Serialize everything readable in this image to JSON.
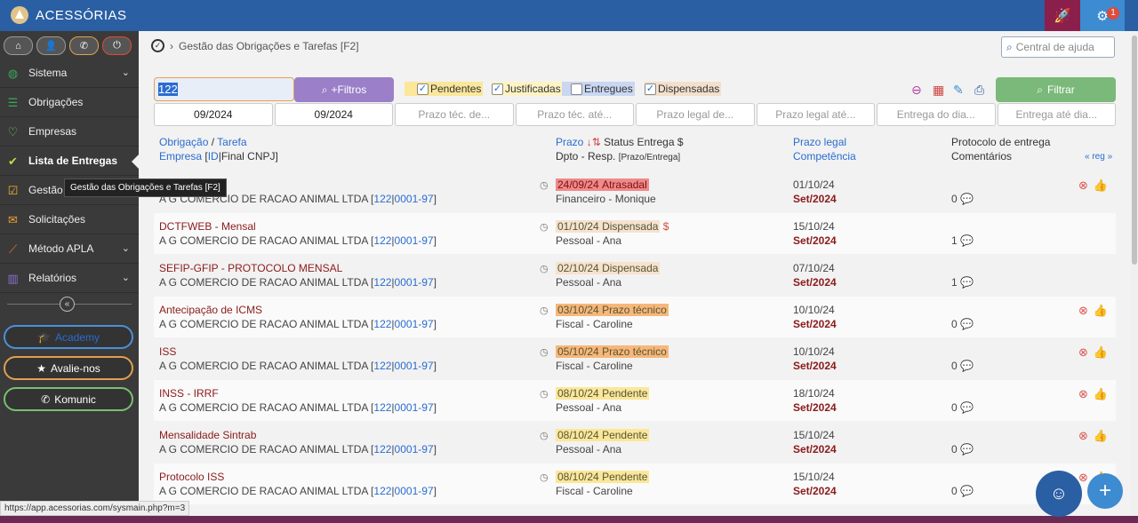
{
  "app": {
    "brand": "ACESSÓRIAS",
    "notification_count": "1"
  },
  "sidebar": {
    "items": [
      {
        "label": "Sistema",
        "icon": "globe-icon",
        "color": "#3aa55a",
        "has_chevron": true
      },
      {
        "label": "Obrigações",
        "icon": "list-icon",
        "color": "#3aa55a",
        "has_chevron": false
      },
      {
        "label": "Empresas",
        "icon": "heart-icon",
        "color": "#7ac070",
        "has_chevron": false
      },
      {
        "label": "Lista de Entregas",
        "icon": "check-circle-icon",
        "color": "#c8d84a",
        "has_chevron": false
      },
      {
        "label": "Gestão de processos",
        "icon": "checkbox-icon",
        "color": "#f0b030",
        "has_chevron": false
      },
      {
        "label": "Solicitações",
        "icon": "chat-icon",
        "color": "#f0a030",
        "has_chevron": false
      },
      {
        "label": "Método APLA",
        "icon": "trend-icon",
        "color": "#f07030",
        "has_chevron": true
      },
      {
        "label": "Relatórios",
        "icon": "book-icon",
        "color": "#8a70d0",
        "has_chevron": true
      }
    ],
    "academy": "Academy",
    "avalie": "Avalie-nos",
    "komunic": "Komunic"
  },
  "tooltip": "Gestão das Obrigações e Tarefas [F2]",
  "breadcrumb": {
    "title": "Gestão das Obrigações e Tarefas [F2]"
  },
  "help_search": {
    "placeholder": "Central de ajuda"
  },
  "filters": {
    "search_value": "122",
    "more_filters": "+Filtros",
    "pendentes": "Pendentes",
    "justificadas": "Justificadas",
    "entregues": "Entregues",
    "dispensadas": "Dispensadas",
    "filtrar": "Filtrar"
  },
  "dates": [
    {
      "value": "09/2024",
      "placeholder": ""
    },
    {
      "value": "09/2024",
      "placeholder": ""
    },
    {
      "value": "",
      "placeholder": "Prazo téc. de..."
    },
    {
      "value": "",
      "placeholder": "Prazo téc. até..."
    },
    {
      "value": "",
      "placeholder": "Prazo legal de..."
    },
    {
      "value": "",
      "placeholder": "Prazo legal até..."
    },
    {
      "value": "",
      "placeholder": "Entrega do dia..."
    },
    {
      "value": "",
      "placeholder": "Entrega até dia..."
    }
  ],
  "table": {
    "h_obrigacao": "Obrigação",
    "h_tarefa": "Tarefa",
    "h_empresa": "Empresa",
    "h_id": "ID",
    "h_final": "Final CNPJ",
    "h_prazo": "Prazo",
    "h_status": "Status Entrega $",
    "h_dpto": "Dpto - Resp.",
    "h_prazo_entrega": "[Prazo/Entrega]",
    "h_prazo_legal": "Prazo legal",
    "h_competencia": "Competência",
    "h_protocolo": "Protocolo de entrega",
    "h_comentarios": "Comentários",
    "h_reg": "« reg »",
    "rows": [
      {
        "name": "",
        "company": "A G COMERCIO DE RACAO ANIMAL LTDA",
        "id": "122",
        "cnpj": "0001-97",
        "prazo": "24/09/24",
        "status": "Atrasadal",
        "status_type": "atrasada",
        "dollar": "",
        "dept": "Financeiro - Monique",
        "legal": "01/10/24",
        "comp": "Set/2024",
        "comments": "0",
        "actions": true
      },
      {
        "name": "DCTFWEB - Mensal",
        "company": "A G COMERCIO DE RACAO ANIMAL LTDA",
        "id": "122",
        "cnpj": "0001-97",
        "prazo": "01/10/24",
        "status": "Dispensada",
        "status_type": "dispensada",
        "dollar": "$",
        "dept": "Pessoal - Ana",
        "legal": "15/10/24",
        "comp": "Set/2024",
        "comments": "1",
        "actions": false
      },
      {
        "name": "SEFIP-GFIP - PROTOCOLO MENSAL",
        "company": "A G COMERCIO DE RACAO ANIMAL LTDA",
        "id": "122",
        "cnpj": "0001-97",
        "prazo": "02/10/24",
        "status": "Dispensada",
        "status_type": "dispensada",
        "dollar": "",
        "dept": "Pessoal - Ana",
        "legal": "07/10/24",
        "comp": "Set/2024",
        "comments": "1",
        "actions": false
      },
      {
        "name": "Antecipação de ICMS",
        "company": "A G COMERCIO DE RACAO ANIMAL LTDA",
        "id": "122",
        "cnpj": "0001-97",
        "prazo": "03/10/24",
        "status": "Prazo técnico",
        "status_type": "tecnico",
        "dollar": "",
        "dept": "Fiscal - Caroline",
        "legal": "10/10/24",
        "comp": "Set/2024",
        "comments": "0",
        "actions": true
      },
      {
        "name": "ISS",
        "company": "A G COMERCIO DE RACAO ANIMAL LTDA",
        "id": "122",
        "cnpj": "0001-97",
        "prazo": "05/10/24",
        "status": "Prazo técnico",
        "status_type": "tecnico",
        "dollar": "",
        "dept": "Fiscal - Caroline",
        "legal": "10/10/24",
        "comp": "Set/2024",
        "comments": "0",
        "actions": true
      },
      {
        "name": "INSS - IRRF",
        "company": "A G COMERCIO DE RACAO ANIMAL LTDA",
        "id": "122",
        "cnpj": "0001-97",
        "prazo": "08/10/24",
        "status": "Pendente",
        "status_type": "pendente",
        "dollar": "",
        "dept": "Pessoal - Ana",
        "legal": "18/10/24",
        "comp": "Set/2024",
        "comments": "0",
        "actions": true
      },
      {
        "name": "Mensalidade Sintrab",
        "company": "A G COMERCIO DE RACAO ANIMAL LTDA",
        "id": "122",
        "cnpj": "0001-97",
        "prazo": "08/10/24",
        "status": "Pendente",
        "status_type": "pendente",
        "dollar": "",
        "dept": "Pessoal - Ana",
        "legal": "15/10/24",
        "comp": "Set/2024",
        "comments": "0",
        "actions": true
      },
      {
        "name": "Protocolo ISS",
        "company": "A G COMERCIO DE RACAO ANIMAL LTDA",
        "id": "122",
        "cnpj": "0001-97",
        "prazo": "08/10/24",
        "status": "Pendente",
        "status_type": "pendente",
        "dollar": "",
        "dept": "Fiscal - Caroline",
        "legal": "15/10/24",
        "comp": "Set/2024",
        "comments": "0",
        "actions": true
      }
    ]
  },
  "status_url": "https://app.acessorias.com/sysmain.php?m=3"
}
